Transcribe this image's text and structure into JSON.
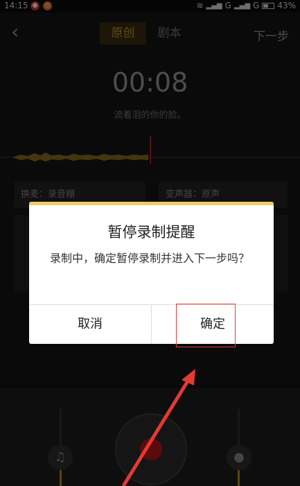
{
  "status": {
    "time": "14:15",
    "signal": "G",
    "signal2": "G",
    "battery": "43%"
  },
  "header": {
    "tabs": [
      "原创",
      "剧本"
    ],
    "next_label": "下一步"
  },
  "recording": {
    "timer": "00:08",
    "lyric": "流着泪的你的脸。"
  },
  "options": {
    "accompaniment": "换麦：录音棚",
    "voice_changer": "变声器：原声"
  },
  "dialog": {
    "title": "暂停录制提醒",
    "message": "录制中，确定暂停录制并进入下一步吗？",
    "cancel": "取消",
    "confirm": "确定"
  },
  "colors": {
    "accent": "#c8961e",
    "dialog_strip": "#f2c96a",
    "record": "#b4191a",
    "highlight": "#e53935"
  },
  "icons": {
    "back": "back-arrow-icon",
    "music": "music-note-icon",
    "mic": "microphone-icon"
  }
}
